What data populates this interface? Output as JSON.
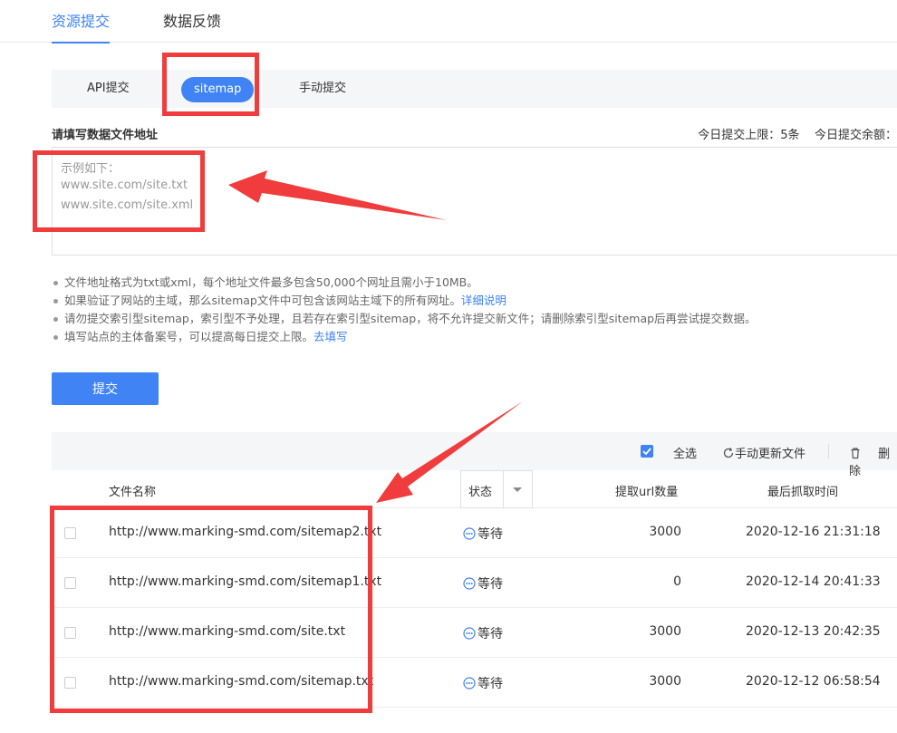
{
  "top_tabs": [
    {
      "label": "资源提交",
      "active": true
    },
    {
      "label": "数据反馈",
      "active": false
    }
  ],
  "sub_tabs": [
    {
      "label": "API提交",
      "active": false
    },
    {
      "label": "sitemap",
      "active": true
    },
    {
      "label": "手动提交",
      "active": false
    }
  ],
  "form": {
    "field_label": "请填写数据文件地址",
    "quota_text": "今日提交上限：5条    今日提交余额：",
    "placeholder_lines": [
      "示例如下：",
      "www.site.com/site.txt",
      "www.site.com/site.xml"
    ]
  },
  "tips": [
    {
      "text": "文件地址格式为txt或xml，每个地址文件最多包含50,000个网址且需小于10MB。",
      "link": ""
    },
    {
      "text": "如果验证了网站的主域，那么sitemap文件中可包含该网站主域下的所有网址。",
      "link": "详细说明"
    },
    {
      "text": "请勿提交索引型sitemap，索引型不予处理，且若存在索引型sitemap，将不允许提交新文件；请删除索引型sitemap后再尝试提交数据。",
      "link": ""
    },
    {
      "text": "填写站点的主体备案号，可以提高每日提交上限。",
      "link": "去填写"
    }
  ],
  "submit_label": "提交",
  "toolbar": {
    "select_all": "全选",
    "refresh": "手动更新文件",
    "delete": "删除"
  },
  "table": {
    "headers": {
      "file": "文件名称",
      "status": "状态",
      "count": "提取url数量",
      "time": "最后抓取时间"
    },
    "rows": [
      {
        "file": "http://www.marking-smd.com/sitemap2.txt",
        "status": "等待",
        "count": "3000",
        "time": "2020-12-16 21:31:18"
      },
      {
        "file": "http://www.marking-smd.com/sitemap1.txt",
        "status": "等待",
        "count": "0",
        "time": "2020-12-14 20:41:33"
      },
      {
        "file": "http://www.marking-smd.com/site.txt",
        "status": "等待",
        "count": "3000",
        "time": "2020-12-13 20:42:35"
      },
      {
        "file": "http://www.marking-smd.com/sitemap.txt",
        "status": "等待",
        "count": "3000",
        "time": "2020-12-12 06:58:54"
      }
    ]
  },
  "colors": {
    "accent": "#3f83f4",
    "annotation": "#f03c3c"
  }
}
